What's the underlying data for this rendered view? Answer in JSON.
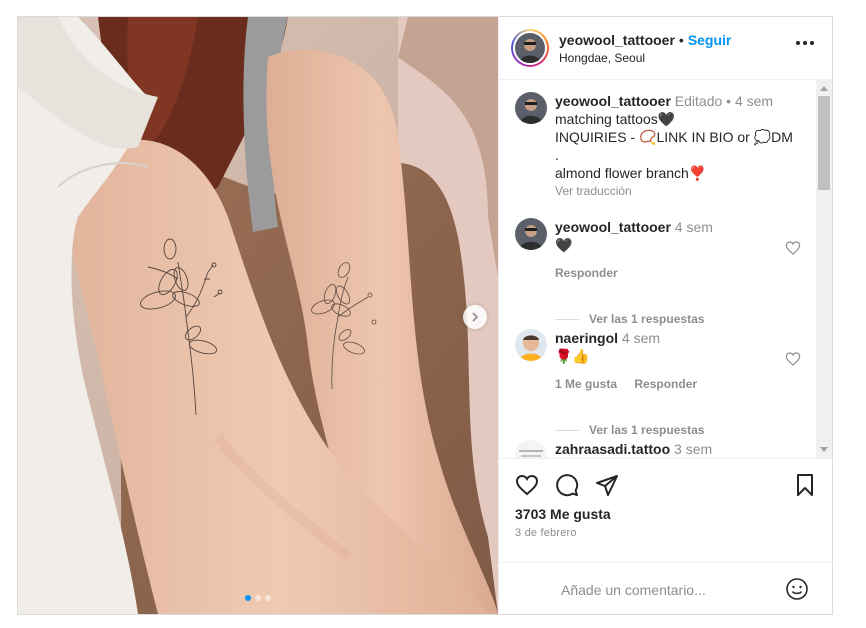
{
  "header": {
    "username": "yeowool_tattooer",
    "separator": "•",
    "follow_label": "Seguir",
    "location": "Hongdae, Seoul"
  },
  "caption": {
    "username": "yeowool_tattooer",
    "edited": "Editado",
    "dot": "•",
    "time": "4 sem",
    "line1": "matching tattoos🖤",
    "line2": "INQUIRIES - 📿LINK IN BIO or 💭DM",
    "line3": ".",
    "line4": "almond flower branch❣️",
    "translate_label": "Ver traducción"
  },
  "comments": [
    {
      "username": "yeowool_tattooer",
      "time": "4 sem",
      "text": "🖤",
      "likes_label": "",
      "reply_label": "Responder",
      "view_replies": "Ver las 1 respuestas"
    },
    {
      "username": "naeringol",
      "time": "4 sem",
      "text": "🌹👍",
      "likes_label": "1 Me gusta",
      "reply_label": "Responder",
      "view_replies": "Ver las 1 respuestas"
    },
    {
      "username": "zahraasadi.tattoo",
      "time": "3 sem"
    }
  ],
  "actions": {
    "like": "heart-icon",
    "comment": "comment-icon",
    "share": "share-icon",
    "save": "bookmark-icon"
  },
  "likes_count": "3703 Me gusta",
  "date": "3 de febrero",
  "add_comment": {
    "placeholder": "Añade un comentario..."
  },
  "carousel": {
    "total": 3,
    "active": 1
  },
  "colors": {
    "accent": "#0095f6",
    "text": "#262626",
    "secondary": "#8e8e8e",
    "border": "#dbdbdb"
  }
}
